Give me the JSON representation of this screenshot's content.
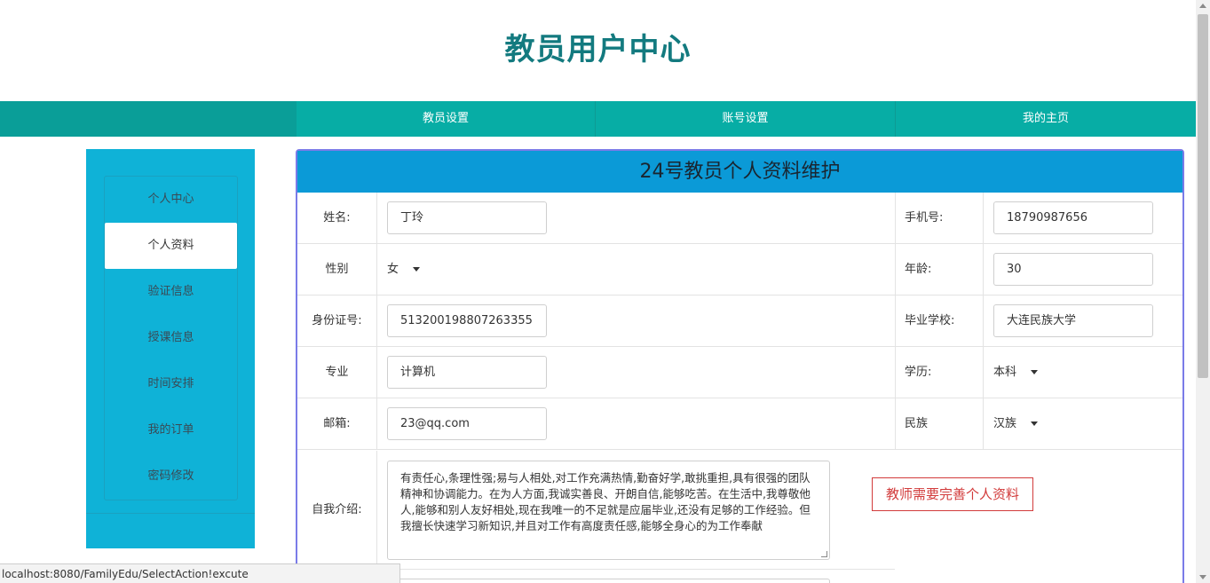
{
  "site": {
    "title": "教员用户中心"
  },
  "nav": {
    "items": [
      "教员设置",
      "账号设置",
      "我的主页"
    ]
  },
  "sidebar": {
    "items": [
      {
        "label": "个人中心",
        "active": false
      },
      {
        "label": "个人资料",
        "active": true
      },
      {
        "label": "验证信息",
        "active": false
      },
      {
        "label": "授课信息",
        "active": false
      },
      {
        "label": "时间安排",
        "active": false
      },
      {
        "label": "我的订单",
        "active": false
      },
      {
        "label": "密码修改",
        "active": false
      }
    ]
  },
  "panel": {
    "title": "24号教员个人资料维护",
    "fields": {
      "name": {
        "label": "姓名:",
        "value": "丁玲"
      },
      "phone": {
        "label": "手机号:",
        "value": "18790987656"
      },
      "gender": {
        "label": "性别",
        "value": "女"
      },
      "age": {
        "label": "年龄:",
        "value": "30"
      },
      "idcard": {
        "label": "身份证号:",
        "value": "513200198807263355"
      },
      "school": {
        "label": "毕业学校:",
        "value": "大连民族大学"
      },
      "major": {
        "label": "专业",
        "value": "计算机"
      },
      "education": {
        "label": "学历:",
        "value": "本科"
      },
      "email": {
        "label": "邮箱:",
        "value": "23@qq.com"
      },
      "ethnicity": {
        "label": "民族",
        "value": "汉族"
      },
      "intro": {
        "label": "自我介绍:",
        "value": "有责任心,条理性强;易与人相处,对工作充满热情,勤奋好学,敢挑重担,具有很强的团队精神和协调能力。在为人方面,我诚实善良、开朗自信,能够吃苦。在生活中,我尊敬他人,能够和别人友好相处,现在我唯一的不足就是应届毕业,还没有足够的工作经验。但我擅长快速学习新知识,并且对工作有高度责任感,能够全身心的为工作奉献"
      }
    },
    "notice": "教师需要完善个人资料"
  },
  "statusbar": {
    "url": "localhost:8080/FamilyEdu/SelectAction!excute"
  },
  "colors": {
    "accent": "#07ada5",
    "sidebar": "#0fb2d7",
    "panel_head": "#0b9ad7",
    "title": "#137a7f",
    "notice": "#d23b3b"
  }
}
